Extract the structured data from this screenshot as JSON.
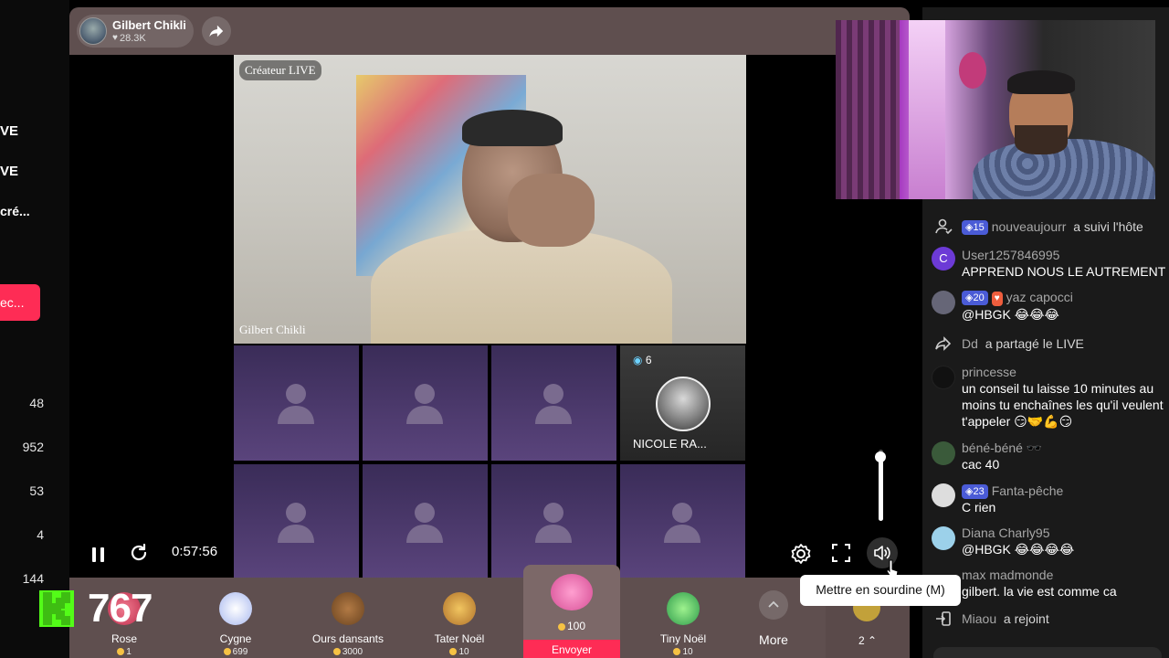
{
  "left_strip": {
    "text1": "VE",
    "text2": "VE",
    "text3": "cré...",
    "button": "ec...",
    "numbers": [
      "48",
      "952",
      "53",
      "4",
      "144"
    ]
  },
  "player": {
    "host_name": "Gilbert Chikli",
    "host_likes": "28.3K",
    "creator_tag": "Créateur LIVE",
    "main_video_name": "Gilbert Chikli",
    "guest_nicole": {
      "badge": "6",
      "name": "NICOLE RA..."
    },
    "time": "0:57:56",
    "volume_level": 0.9,
    "icons": {
      "share": "share-icon",
      "pause": "pause-icon",
      "refresh": "refresh-icon",
      "settings": "settings-icon",
      "fullscreen": "fullscreen-icon",
      "volume": "volume-icon"
    }
  },
  "tooltip": "Mettre en sourdine (M)",
  "overlay_counter": "767",
  "gifts": [
    {
      "name": "Rose",
      "price": "1",
      "color": "#e34c6c"
    },
    {
      "name": "Cygne",
      "price": "699",
      "color": "#cfd9ff"
    },
    {
      "name": "Ours dansants",
      "price": "3000",
      "color": "#8a5a2b"
    },
    {
      "name": "Tater Noël",
      "price": "10",
      "color": "#d6a23a"
    },
    {
      "name": "Tiny Noël",
      "price": "10",
      "color": "#4cc96a"
    }
  ],
  "featured_gift": {
    "price": "100",
    "send": "Envoyer",
    "color": "#f07bb8"
  },
  "more_label": "More",
  "extra_count": "2",
  "chat": [
    {
      "type": "system",
      "icon": "follow-icon",
      "level": "15",
      "user": "nouveaujourr",
      "text": "a suivi l'hôte"
    },
    {
      "type": "message",
      "avatar_letter": "C",
      "avatar_color": "#6c3ad6",
      "user": "User1257846995",
      "text": "APPREND NOUS LE AUTREMENT 😂"
    },
    {
      "type": "message",
      "level": "20",
      "fan": "♥",
      "avatar_color": "#667",
      "user": "yaz capocci",
      "text": "@HBGK 😂😂😂"
    },
    {
      "type": "system",
      "icon": "share-icon",
      "user": "Dd",
      "text": "a partagé le LIVE"
    },
    {
      "type": "message",
      "avatar_color": "#111",
      "user": "princesse",
      "text": "un conseil tu laisse 10 minutes au moins tu enchaînes les qu'il veulent t'appeler 😏🤝💪😏"
    },
    {
      "type": "message",
      "avatar_color": "#3a5a3a",
      "user": "béné-béné 🕶️",
      "text": "cac 40"
    },
    {
      "type": "message",
      "level": "23",
      "avatar_color": "#ddd",
      "user": "Fanta-pêche",
      "text": "C rien"
    },
    {
      "type": "message",
      "avatar_color": "#9cd1ea",
      "user": "Diana Charly95",
      "text": "@HBGK 😂😂😂😂"
    },
    {
      "type": "message",
      "avatar_color": "#1a1a1a",
      "user": "max madmonde",
      "text": "gilbert. la vie est comme ca"
    },
    {
      "type": "system",
      "icon": "join-icon",
      "user": "Miaou",
      "text": "a rejoint"
    }
  ]
}
